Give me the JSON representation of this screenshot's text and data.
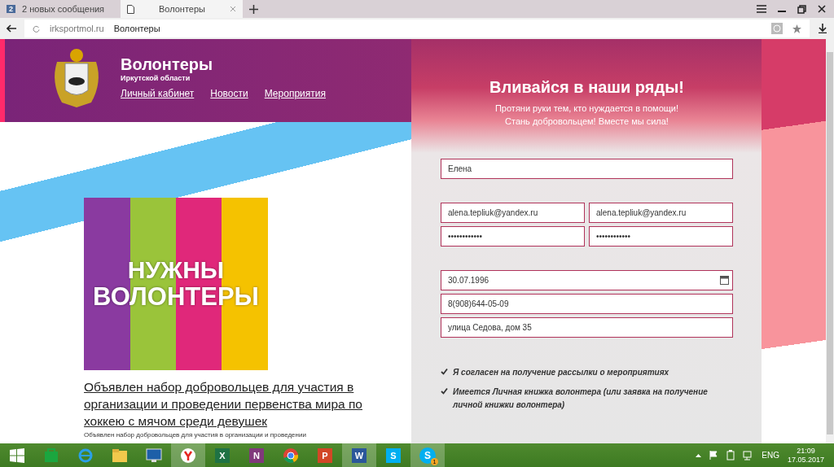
{
  "browser": {
    "tabs": [
      {
        "label": "2 новых сообщения",
        "badge": "2",
        "selected": false
      },
      {
        "label": "Волонтеры",
        "selected": true
      }
    ],
    "address": {
      "domain": "irksportmol.ru",
      "title": "Волонтеры"
    }
  },
  "header": {
    "title": "Волонтеры",
    "subtitle": "Иркутской области",
    "nav": [
      "Личный кабинет",
      "Новости",
      "Мероприятия"
    ]
  },
  "poster": {
    "lines": [
      "НУЖНЫ",
      "ВОЛОНТЕРЫ"
    ]
  },
  "news": {
    "headline": "Объявлен набор добровольцев для участия в организации и проведении первенства мира по хоккею с мячом среди девушек",
    "snippet": "Объявлен набор добровольцев для участия в организации и проведении"
  },
  "form": {
    "heading": "Вливайся в наши ряды!",
    "lines": [
      "Протяни руки тем, кто нуждается в помощи!",
      "Стань добровольцем! Вместе мы сила!"
    ],
    "groups": [
      [
        [
          "Елена"
        ]
      ],
      [
        [
          "alena.tepliuk@yandex.ru",
          "alena.tepliuk@yandex.ru"
        ],
        [
          "••••••••••••",
          "••••••••••••"
        ]
      ],
      [
        [
          "30.07.1996"
        ],
        [
          "8(908)644-05-09"
        ],
        [
          "улица Седова, дом 35"
        ]
      ]
    ],
    "checkboxes": [
      {
        "label": "Я согласен на получение рассылки о мероприятиях",
        "checked": true
      },
      {
        "label": "Имеется Личная книжка волонтера (или заявка на получение личной книжки волонтера)",
        "checked": true
      }
    ]
  },
  "taskbar": {
    "apps": [
      {
        "kind": "store",
        "active": false
      },
      {
        "kind": "ie",
        "active": false
      },
      {
        "kind": "folder",
        "active": false
      },
      {
        "kind": "monitor",
        "active": false
      },
      {
        "kind": "yandex",
        "active": true
      },
      {
        "kind": "tile",
        "letter": "X",
        "color": "#1f7244",
        "active": false
      },
      {
        "kind": "tile",
        "letter": "N",
        "color": "#80397b",
        "active": false
      },
      {
        "kind": "chrome",
        "active": false
      },
      {
        "kind": "tile",
        "letter": "P",
        "color": "#d24726",
        "active": false
      },
      {
        "kind": "tile",
        "letter": "W",
        "color": "#2b579a",
        "active": true
      },
      {
        "kind": "tile",
        "letter": "S",
        "color": "#00aff0",
        "active": false
      },
      {
        "kind": "skype",
        "letter": "S",
        "badge": "1",
        "active": true
      }
    ],
    "tray": {
      "lang": "ENG",
      "time": "21:09",
      "date": "17.05.2017"
    }
  }
}
